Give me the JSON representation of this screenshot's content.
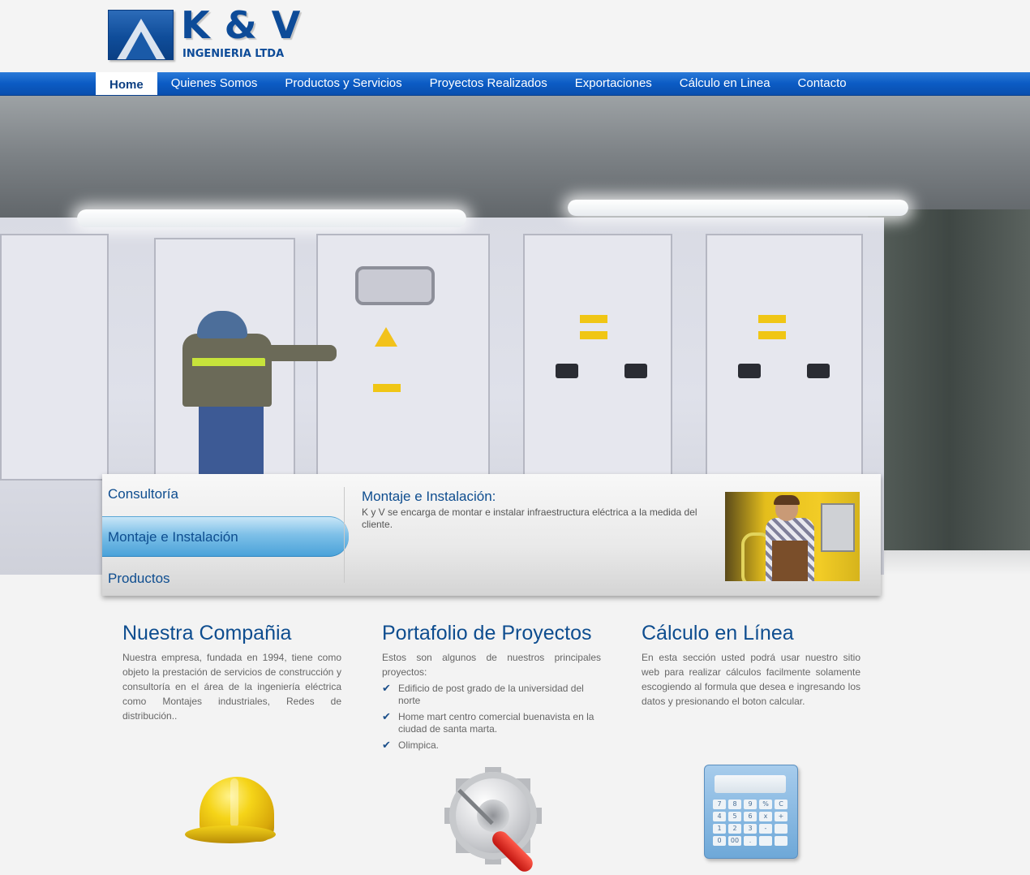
{
  "brand": {
    "name": "K & V",
    "subtitle": "INGENIERIA LTDA"
  },
  "nav": {
    "items": [
      {
        "label": "Home",
        "active": true
      },
      {
        "label": "Quienes Somos"
      },
      {
        "label": "Productos y Servicios"
      },
      {
        "label": "Proyectos Realizados"
      },
      {
        "label": "Exportaciones"
      },
      {
        "label": "Cálculo en Linea"
      },
      {
        "label": "Contacto"
      }
    ]
  },
  "slider": {
    "tabs": [
      {
        "label": "Consultoría"
      },
      {
        "label": "Montaje e Instalación",
        "active": true
      },
      {
        "label": "Productos"
      }
    ],
    "active_title": "Montaje e Instalación:",
    "active_text": "K y V se encarga de montar e instalar infraestructura eléctrica a la medida del cliente."
  },
  "columns": [
    {
      "title": "Nuestra Compañia",
      "text": "Nuestra empresa, fundada en 1994, tiene como objeto la prestación de servicios de construcción y consultoría en el área de la ingeniería eléctrica como Montajes industriales, Redes de distribución.."
    },
    {
      "title": "Portafolio de Proyectos",
      "text": "Estos son algunos de nuestros principales proyectos:",
      "items": [
        "Edificio de post grado de la universidad del norte",
        "Home mart centro comercial buenavista en la ciudad de santa marta.",
        "Olimpica."
      ]
    },
    {
      "title": "Cálculo en Línea",
      "text": "En esta sección usted podrá usar nuestro sitio web para realizar cálculos facilmente solamente escogiendo al formula que desea e ingresando los datos y presionando el boton calcular."
    }
  ],
  "icons": {
    "col1": "hard-hat-icon",
    "col2": "gear-screwdriver-icon",
    "col3": "calculator-icon",
    "check": "checkmark-icon"
  },
  "calculator_keys": [
    "7",
    "8",
    "9",
    "%",
    "C",
    "4",
    "5",
    "6",
    "x",
    "+",
    "1",
    "2",
    "3",
    "-",
    "",
    "0",
    "00",
    ".",
    "",
    ""
  ],
  "colors": {
    "nav_blue": "#0b5bc4",
    "heading_blue": "#0e4d8f",
    "active_tab": "#4aa2d9"
  }
}
